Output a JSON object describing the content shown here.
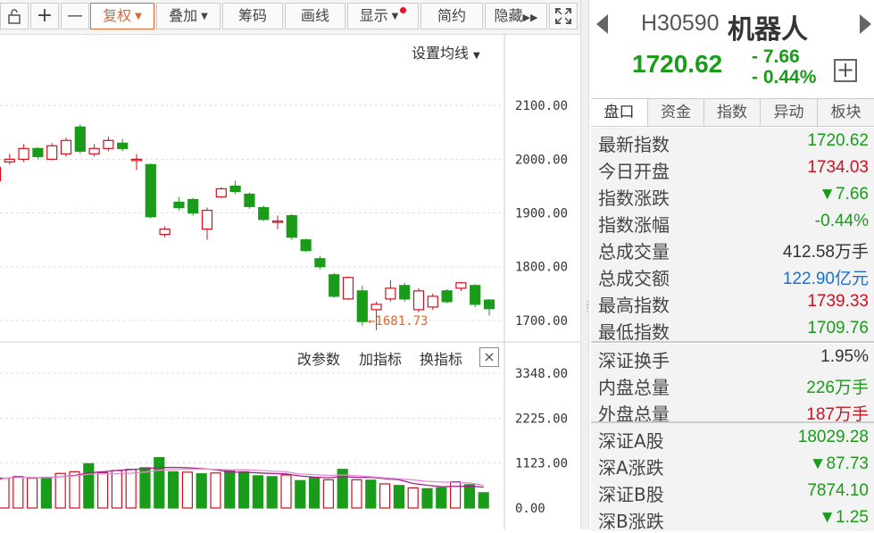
{
  "toolbar": {
    "lock_icon": "lock-icon",
    "zoom_in": "+",
    "zoom_out": "—",
    "buttons": [
      "复权",
      "叠加",
      "筹码",
      "画线",
      "显示",
      "简约",
      "隐藏"
    ],
    "fullscreen_icon": "fullscreen-icon"
  },
  "chart": {
    "ma_setting": "设置均线",
    "low_marker": "←1681.73",
    "indicator_actions": [
      "改参数",
      "加指标",
      "换指标"
    ],
    "close": "×"
  },
  "chart_data": {
    "type": "candlestick",
    "y_ticks": [
      "2100.00",
      "2000.00",
      "1900.00",
      "1800.00",
      "1700.00"
    ],
    "ylim": [
      1660,
      2200
    ],
    "volume_ticks": [
      "3348.00",
      "2225.00",
      "1123.00",
      "0.00"
    ],
    "volume_ylim": [
      0,
      3348
    ],
    "candles": [
      {
        "o": 1960,
        "c": 1985,
        "h": 1990,
        "l": 1958
      },
      {
        "o": 1995,
        "c": 2000,
        "h": 2010,
        "l": 1990
      },
      {
        "o": 2000,
        "c": 2020,
        "h": 2028,
        "l": 1995
      },
      {
        "o": 2020,
        "c": 2005,
        "h": 2022,
        "l": 2000
      },
      {
        "o": 2000,
        "c": 2025,
        "h": 2030,
        "l": 1998
      },
      {
        "o": 2010,
        "c": 2035,
        "h": 2040,
        "l": 2005
      },
      {
        "o": 2060,
        "c": 2015,
        "h": 2065,
        "l": 2010
      },
      {
        "o": 2010,
        "c": 2020,
        "h": 2028,
        "l": 2005
      },
      {
        "o": 2020,
        "c": 2035,
        "h": 2042,
        "l": 2015
      },
      {
        "o": 2030,
        "c": 2020,
        "h": 2038,
        "l": 2015
      },
      {
        "o": 2000,
        "c": 2000,
        "h": 2010,
        "l": 1980
      },
      {
        "o": 1990,
        "c": 1893,
        "h": 1992,
        "l": 1890
      },
      {
        "o": 1860,
        "c": 1870,
        "h": 1875,
        "l": 1855
      },
      {
        "o": 1920,
        "c": 1910,
        "h": 1930,
        "l": 1905
      },
      {
        "o": 1925,
        "c": 1900,
        "h": 1928,
        "l": 1895
      },
      {
        "o": 1870,
        "c": 1905,
        "h": 1910,
        "l": 1850
      },
      {
        "o": 1930,
        "c": 1945,
        "h": 1948,
        "l": 1928
      },
      {
        "o": 1950,
        "c": 1940,
        "h": 1960,
        "l": 1935
      },
      {
        "o": 1935,
        "c": 1912,
        "h": 1938,
        "l": 1908
      },
      {
        "o": 1910,
        "c": 1888,
        "h": 1914,
        "l": 1885
      },
      {
        "o": 1885,
        "c": 1885,
        "h": 1895,
        "l": 1870
      },
      {
        "o": 1895,
        "c": 1855,
        "h": 1898,
        "l": 1850
      },
      {
        "o": 1850,
        "c": 1830,
        "h": 1852,
        "l": 1828
      },
      {
        "o": 1815,
        "c": 1800,
        "h": 1820,
        "l": 1795
      },
      {
        "o": 1785,
        "c": 1745,
        "h": 1788,
        "l": 1742
      },
      {
        "o": 1740,
        "c": 1780,
        "h": 1782,
        "l": 1738
      },
      {
        "o": 1755,
        "c": 1698,
        "h": 1765,
        "l": 1690
      },
      {
        "o": 1720,
        "c": 1730,
        "h": 1735,
        "l": 1682
      },
      {
        "o": 1740,
        "c": 1760,
        "h": 1775,
        "l": 1735
      },
      {
        "o": 1765,
        "c": 1740,
        "h": 1770,
        "l": 1735
      },
      {
        "o": 1720,
        "c": 1755,
        "h": 1760,
        "l": 1715
      },
      {
        "o": 1725,
        "c": 1745,
        "h": 1750,
        "l": 1720
      },
      {
        "o": 1755,
        "c": 1735,
        "h": 1758,
        "l": 1732
      },
      {
        "o": 1760,
        "c": 1770,
        "h": 1772,
        "l": 1755
      },
      {
        "o": 1765,
        "c": 1730,
        "h": 1768,
        "l": 1725
      },
      {
        "o": 1738,
        "c": 1722,
        "h": 1740,
        "l": 1709
      }
    ],
    "volume": [
      {
        "v": 740,
        "dir": "up"
      },
      {
        "v": 780,
        "dir": "up"
      },
      {
        "v": 740,
        "dir": "up"
      },
      {
        "v": 760,
        "dir": "down"
      },
      {
        "v": 860,
        "dir": "up"
      },
      {
        "v": 900,
        "dir": "up"
      },
      {
        "v": 1100,
        "dir": "down"
      },
      {
        "v": 880,
        "dir": "up"
      },
      {
        "v": 930,
        "dir": "up"
      },
      {
        "v": 960,
        "dir": "up"
      },
      {
        "v": 1000,
        "dir": "down"
      },
      {
        "v": 1250,
        "dir": "down"
      },
      {
        "v": 900,
        "dir": "down"
      },
      {
        "v": 890,
        "dir": "up"
      },
      {
        "v": 850,
        "dir": "down"
      },
      {
        "v": 870,
        "dir": "up"
      },
      {
        "v": 940,
        "dir": "down"
      },
      {
        "v": 900,
        "dir": "down"
      },
      {
        "v": 800,
        "dir": "down"
      },
      {
        "v": 780,
        "dir": "down"
      },
      {
        "v": 820,
        "dir": "up"
      },
      {
        "v": 680,
        "dir": "down"
      },
      {
        "v": 760,
        "dir": "down"
      },
      {
        "v": 700,
        "dir": "up"
      },
      {
        "v": 960,
        "dir": "down"
      },
      {
        "v": 700,
        "dir": "up"
      },
      {
        "v": 690,
        "dir": "down"
      },
      {
        "v": 600,
        "dir": "up"
      },
      {
        "v": 560,
        "dir": "down"
      },
      {
        "v": 500,
        "dir": "up"
      },
      {
        "v": 480,
        "dir": "down"
      },
      {
        "v": 500,
        "dir": "down"
      },
      {
        "v": 650,
        "dir": "up"
      },
      {
        "v": 580,
        "dir": "down"
      },
      {
        "v": 380,
        "dir": "down"
      }
    ]
  },
  "panel": {
    "code": "H30590",
    "name": "机器人",
    "price": "1720.62",
    "change": "- 7.66",
    "change_pct": "- 0.44%",
    "plus": "+",
    "tabs": [
      "盘口",
      "资金",
      "指数",
      "异动",
      "板块"
    ],
    "rows": [
      {
        "k": "最新指数",
        "v": "1720.62",
        "c": "green"
      },
      {
        "k": "今日开盘",
        "v": "1734.03",
        "c": "red"
      },
      {
        "k": "指数涨跌",
        "v": "▼7.66",
        "c": "green"
      },
      {
        "k": "指数涨幅",
        "v": "-0.44%",
        "c": "green"
      },
      {
        "k": "总成交量",
        "v": "412.58万手",
        "c": "dark"
      },
      {
        "k": "总成交额",
        "v": "122.90亿元",
        "c": "blue"
      },
      {
        "k": "最高指数",
        "v": "1739.33",
        "c": "red"
      },
      {
        "k": "最低指数",
        "v": "1709.76",
        "c": "green"
      },
      {
        "k": "深证换手",
        "v": "1.95%",
        "c": "dark"
      },
      {
        "k": "内盘总量",
        "v": "226万手",
        "c": "green"
      },
      {
        "k": "外盘总量",
        "v": "187万手",
        "c": "red"
      },
      {
        "k": "深证A股",
        "v": "18029.28",
        "c": "green"
      },
      {
        "k": "深A涨跌",
        "v": "▼87.73",
        "c": "green"
      },
      {
        "k": "深证B股",
        "v": "7874.10",
        "c": "green"
      },
      {
        "k": "深B涨跌",
        "v": "▼1.25",
        "c": "green"
      }
    ]
  },
  "colors": {
    "up": "#d0101d",
    "down": "#1a9b1a",
    "ma": "#a81c8c"
  }
}
